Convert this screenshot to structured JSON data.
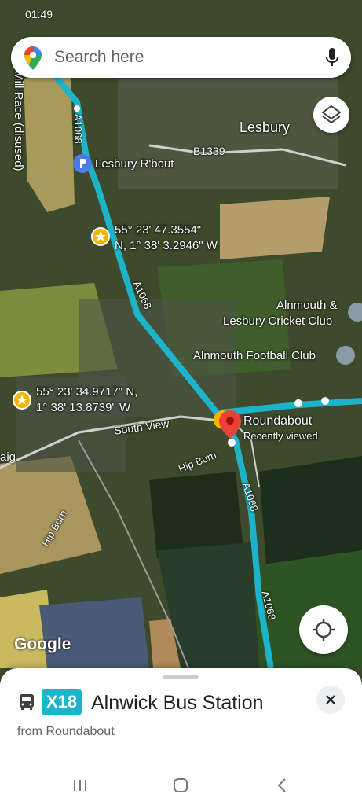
{
  "status_bar": {
    "time": "01:49"
  },
  "search": {
    "placeholder": "Search here"
  },
  "map": {
    "labels": {
      "mill_race": "Mill Race (disused)",
      "a1068_top": "A1068",
      "lesbury": "Lesbury",
      "b1339": "B1339",
      "lesbury_rbout": "Lesbury R'bout",
      "coord1_line1": "55° 23' 47.3554\"",
      "coord1_line2": "N, 1° 38' 3.2946\" W",
      "a1068_mid": "A1068",
      "cricket_line1": "Alnmouth &",
      "cricket_line2": "Lesbury Cricket Club",
      "football": "Alnmouth Football Club",
      "coord2_line1": "55° 23' 34.9717\" N,",
      "coord2_line2": "1° 38' 13.8739\" W",
      "south_view": "South View",
      "roundabout": "Roundabout",
      "recently_viewed": "Recently viewed",
      "aig": "aig",
      "hip_burn_1": "Hip Burn",
      "hip_burn_2": "Hip Burn",
      "a1068_low": "A1068",
      "a1068_bottom": "A1068",
      "google": "Google"
    }
  },
  "sheet": {
    "route": "X18",
    "destination": "Alnwick Bus Station",
    "from": "from Roundabout"
  },
  "colors": {
    "route_line": "#1db3c8",
    "pin": "#ea4335",
    "star": "#f6b400"
  }
}
